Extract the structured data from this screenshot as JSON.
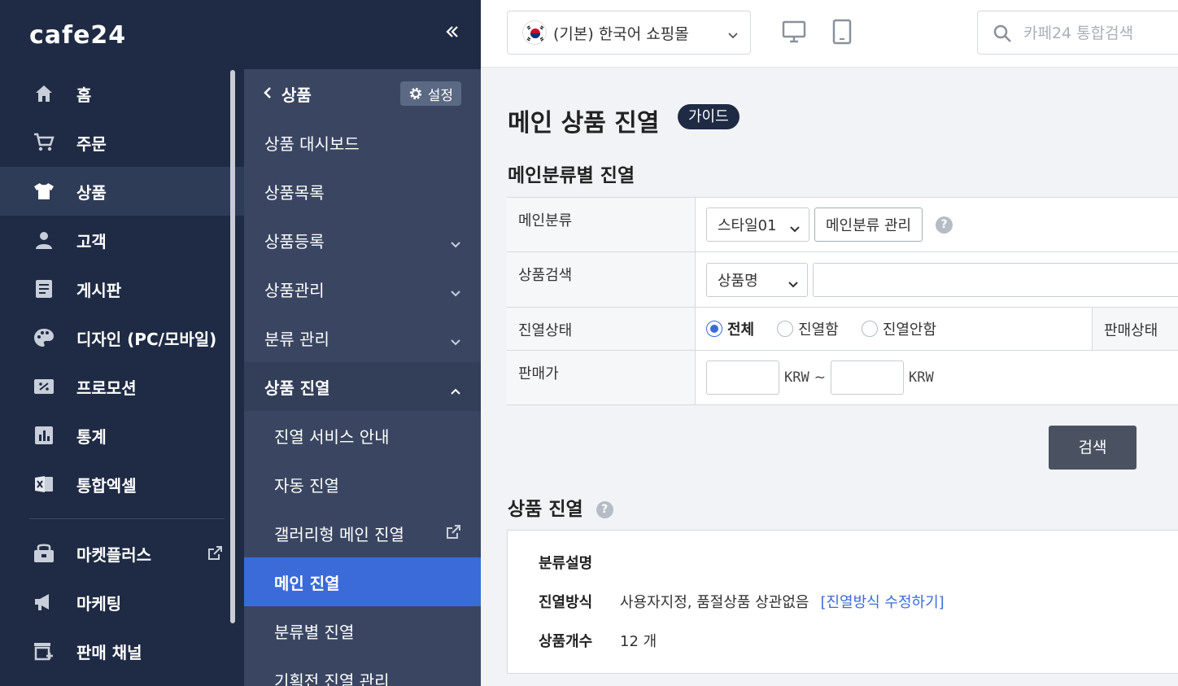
{
  "brand": {
    "logo": "cafe24"
  },
  "sidebar": {
    "items": [
      {
        "label": "홈",
        "icon": "home-icon"
      },
      {
        "label": "주문",
        "icon": "cart-icon"
      },
      {
        "label": "상품",
        "icon": "tshirt-icon",
        "active": true
      },
      {
        "label": "고객",
        "icon": "person-icon"
      },
      {
        "label": "게시판",
        "icon": "board-icon"
      },
      {
        "label": "디자인 (PC/모바일)",
        "icon": "palette-icon"
      },
      {
        "label": "프로모션",
        "icon": "coupon-icon"
      },
      {
        "label": "통계",
        "icon": "stats-icon"
      },
      {
        "label": "통합엑셀",
        "icon": "excel-icon"
      }
    ],
    "items2": [
      {
        "label": "마켓플러스",
        "icon": "market-icon",
        "external": true
      },
      {
        "label": "마케팅",
        "icon": "megaphone-icon"
      },
      {
        "label": "판매 채널",
        "icon": "channel-icon"
      }
    ]
  },
  "subnav": {
    "title": "상품",
    "settings_label": "설정",
    "rows": [
      {
        "label": "상품 대시보드"
      },
      {
        "label": "상품목록"
      },
      {
        "label": "상품등록",
        "chevron": "down"
      },
      {
        "label": "상품관리",
        "chevron": "down"
      },
      {
        "label": "분류 관리",
        "chevron": "down"
      }
    ],
    "group": {
      "label": "상품 진열"
    },
    "subitems": [
      {
        "label": "진열 서비스 안내"
      },
      {
        "label": "자동 진열"
      },
      {
        "label": "갤러리형 메인 진열",
        "external": true
      },
      {
        "label": "메인 진열",
        "active": true
      },
      {
        "label": "분류별 진열"
      },
      {
        "label": "기획전 진열 관리"
      }
    ]
  },
  "topbar": {
    "shop_select": "(기본) 한국어 쇼핑몰",
    "search_placeholder": "카페24 통합검색"
  },
  "main": {
    "title": "메인 상품 진열",
    "guide_label": "가이드",
    "section1": "메인분류별 진열",
    "filters": {
      "main_category_label": "메인분류",
      "main_category_value": "스타일01",
      "manage_button": "메인분류 관리",
      "product_search_label": "상품검색",
      "product_search_field": "상품명",
      "display_status_label": "진열상태",
      "radio_all": "전체",
      "radio_displayed": "진열함",
      "radio_not_displayed": "진열안함",
      "sale_status_label": "판매상태",
      "price_label": "판매가",
      "currency": "KRW",
      "tilde": "~"
    },
    "search_button": "검색",
    "section2": "상품 진열",
    "info": {
      "desc_label": "분류설명",
      "method_label": "진열방식",
      "method_value": "사용자지정, 품절상품 상관없음",
      "method_link": "[진열방식 수정하기]",
      "count_label": "상품개수",
      "count_value": "12 개"
    }
  },
  "colors": {
    "sidebar": "#1f2b44",
    "subnav": "#3a4661",
    "accent": "#3b6bd8"
  }
}
